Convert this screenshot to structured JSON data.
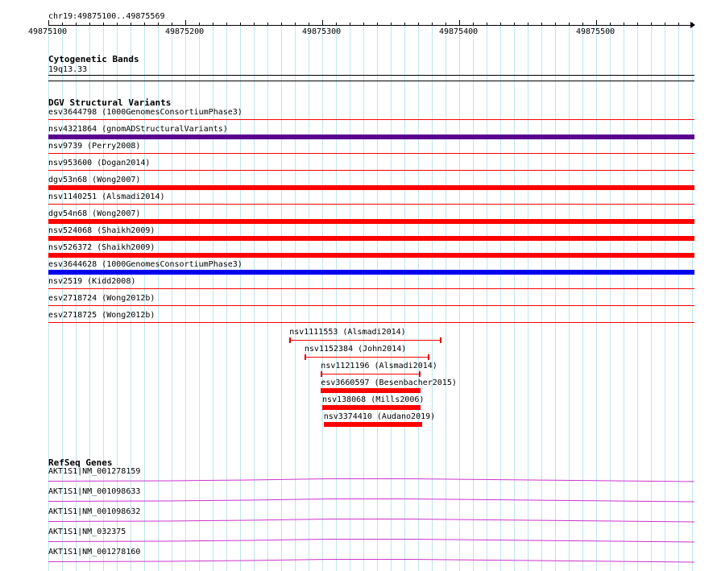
{
  "location": "chr19:49875100..49875569",
  "ruler": {
    "start": 49875100,
    "end": 49875569,
    "labels": [
      "49875100",
      "49875200",
      "49875300",
      "49875400",
      "49875500"
    ]
  },
  "cytobands": {
    "title": "Cytogenetic Bands",
    "band": "19q13.33"
  },
  "dgv": {
    "title": "DGV Structural Variants",
    "full_tracks": [
      {
        "label": "esv3644798 (1000GenomesConsortiumPhase3)",
        "color": "#ff0000",
        "style": "thin"
      },
      {
        "label": "nsv4321864 (gnomADStructuralVariants)",
        "color": "#5a0090",
        "style": "thick"
      },
      {
        "label": "nsv9739 (Perry2008)",
        "color": "#ff0000",
        "style": "thin"
      },
      {
        "label": "nsv953600 (Dogan2014)",
        "color": "#ff0000",
        "style": "thin"
      },
      {
        "label": "dgv53n68 (Wong2007)",
        "color": "#ff0000",
        "style": "thick"
      },
      {
        "label": "nsv1140251 (Alsmadi2014)",
        "color": "#ff0000",
        "style": "thin"
      },
      {
        "label": "dgv54n68 (Wong2007)",
        "color": "#ff0000",
        "style": "thick"
      },
      {
        "label": "nsv524068 (Shaikh2009)",
        "color": "#ff0000",
        "style": "thick"
      },
      {
        "label": "nsv526372 (Shaikh2009)",
        "color": "#ff0000",
        "style": "thick"
      },
      {
        "label": "esv3644628 (1000GenomesConsortiumPhase3)",
        "color": "#0000ee",
        "style": "thick"
      },
      {
        "label": "nsv2519 (Kidd2008)",
        "color": "#ff0000",
        "style": "thin"
      },
      {
        "label": "esv2718724 (Wong2012b)",
        "color": "#ff0000",
        "style": "thin"
      },
      {
        "label": "esv2718725 (Wong2012b)",
        "color": "#ff0000",
        "style": "thin"
      }
    ],
    "short_features": [
      {
        "label": "nsv1111553 (Alsmadi2014)",
        "start": 49875276,
        "end": 49875387,
        "style": "bracket"
      },
      {
        "label": "nsv1152384 (John2014)",
        "start": 49875287,
        "end": 49875378,
        "style": "bracket"
      },
      {
        "label": "nsv1121196 (Alsmadi2014)",
        "start": 49875299,
        "end": 49875372,
        "style": "bracket"
      },
      {
        "label": "esv3660597 (Besenbacher2015)",
        "start": 49875299,
        "end": 49875372,
        "style": "bar"
      },
      {
        "label": "nsv138068 (Mills2006)",
        "start": 49875300,
        "end": 49875372,
        "style": "bar"
      },
      {
        "label": "nsv3374410 (Audano2019)",
        "start": 49875301,
        "end": 49875373,
        "style": "bar"
      }
    ]
  },
  "refseq": {
    "title": "RefSeq Genes",
    "genes": [
      {
        "label": "AKT1S1|NM_001278159"
      },
      {
        "label": "AKT1S1|NM_001098633"
      },
      {
        "label": "AKT1S1|NM_001098632"
      },
      {
        "label": "AKT1S1|NM_032375"
      },
      {
        "label": "AKT1S1|NM_001278160"
      }
    ],
    "color": "#cc33cc"
  },
  "colors": {
    "grid": "#bfe6ee",
    "variant_red": "#ff0000",
    "variant_purple": "#5a0090",
    "variant_blue": "#0000ee"
  }
}
